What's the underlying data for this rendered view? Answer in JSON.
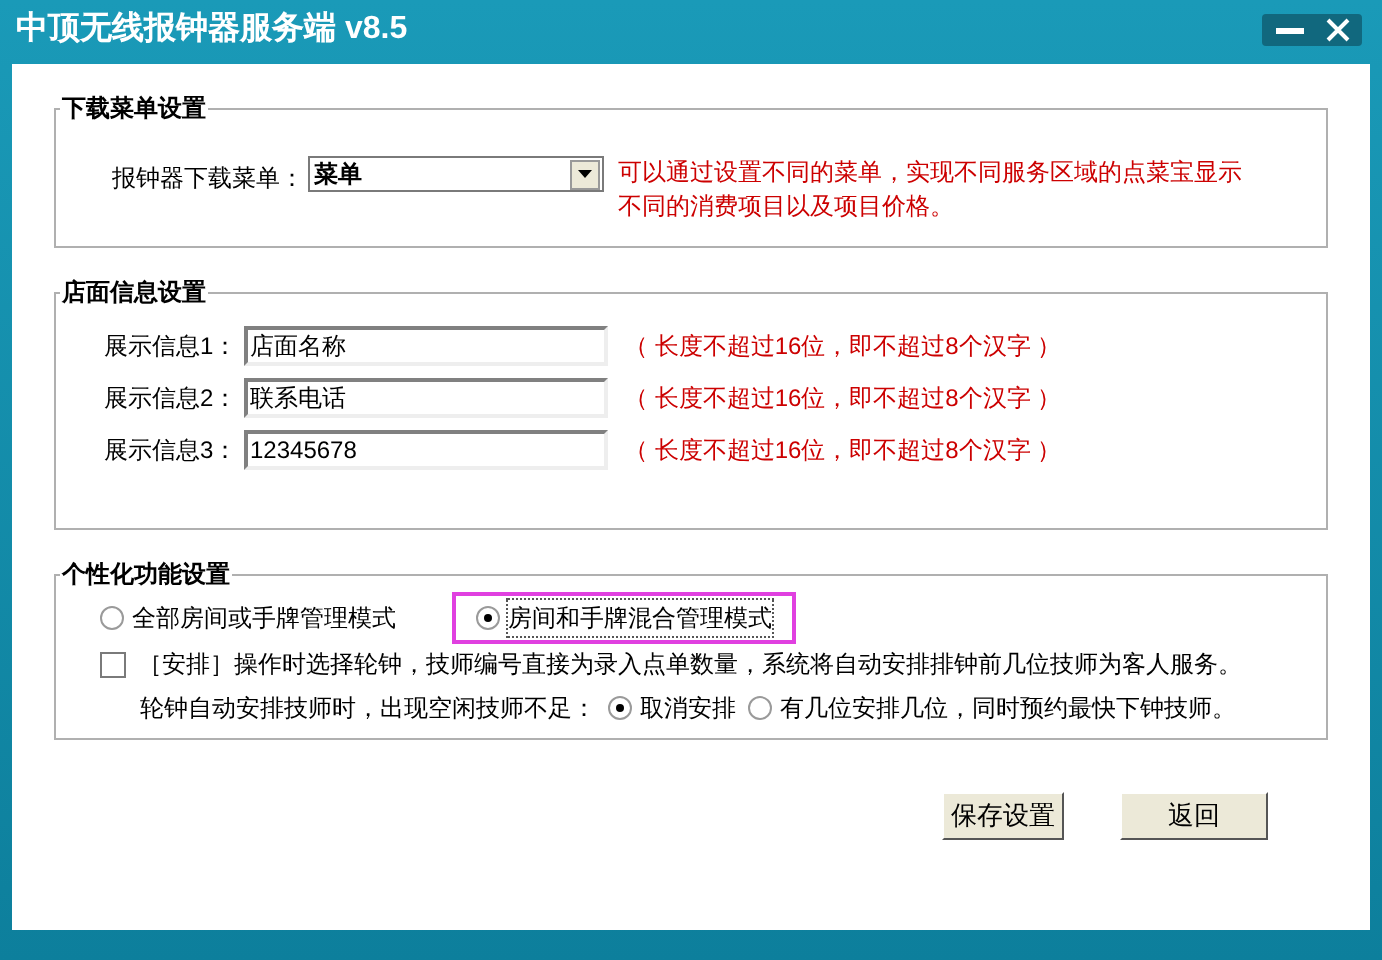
{
  "window": {
    "title": "中顶无线报钟器服务端 v8.5"
  },
  "menu_section": {
    "title": "下载菜单设置",
    "label": "报钟器下载菜单：",
    "value": "菜单",
    "hint_lines": [
      "可以通过设置不同的菜单，实现不同服务区域的点菜宝显示",
      "不同的消费项目以及项目价格。"
    ]
  },
  "store_section": {
    "title": "店面信息设置",
    "fields": [
      {
        "label": "展示信息1：",
        "value": "店面名称",
        "hint": "（ 长度不超过16位，即不超过8个汉字 ）"
      },
      {
        "label": "展示信息2：",
        "value": "联系电话",
        "hint": "（ 长度不超过16位，即不超过8个汉字 ）"
      },
      {
        "label": "展示信息3：",
        "value": "12345678",
        "hint": "（ 长度不超过16位，即不超过8个汉字 ）"
      }
    ]
  },
  "feature_section": {
    "title": "个性化功能设置",
    "modes": [
      {
        "label": "全部房间或手牌管理模式",
        "selected": false,
        "highlighted": false
      },
      {
        "label": "房间和手牌混合管理模式",
        "selected": true,
        "highlighted": true
      }
    ],
    "checkbox": {
      "label": "［安排］操作时选择轮钟，技师编号直接为录入点单数量，系统将自动安排排钟前几位技师为客人服务。",
      "checked": false
    },
    "shortage": {
      "label": "轮钟自动安排技师时，出现空闲技师不足：",
      "options": [
        {
          "label": "取消安排",
          "selected": true
        },
        {
          "label": "有几位安排几位，同时预约最快下钟技师。",
          "selected": false
        }
      ]
    }
  },
  "buttons": [
    "保存设置",
    "返回"
  ]
}
